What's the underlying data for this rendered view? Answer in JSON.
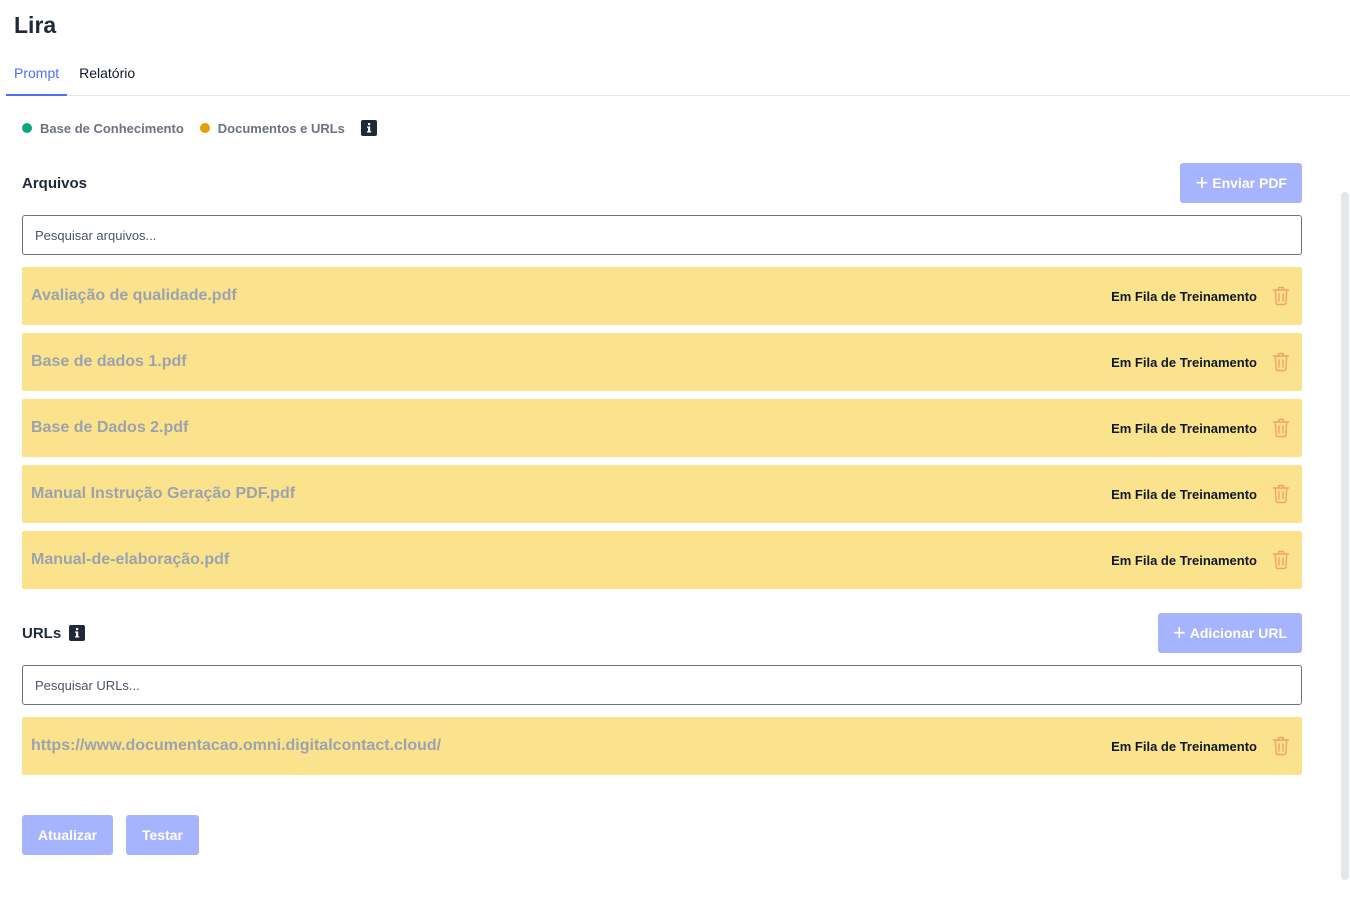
{
  "app": {
    "title": "Lira"
  },
  "tabs": [
    {
      "label": "Prompt",
      "active": true
    },
    {
      "label": "Relatório",
      "active": false
    }
  ],
  "legend": [
    {
      "label": "Base de Conhecimento",
      "color": "#10a37f"
    },
    {
      "label": "Documentos e URLs",
      "color": "#e3a008"
    }
  ],
  "files": {
    "title": "Arquivos",
    "upload_button": "Enviar PDF",
    "search_placeholder": "Pesquisar arquivos...",
    "items": [
      {
        "name": "Avaliação de qualidade.pdf",
        "status": "Em Fila de Treinamento"
      },
      {
        "name": "Base de dados 1.pdf",
        "status": "Em Fila de Treinamento"
      },
      {
        "name": "Base de Dados 2.pdf",
        "status": "Em Fila de Treinamento"
      },
      {
        "name": "Manual Instrução Geração PDF.pdf",
        "status": "Em Fila de Treinamento"
      },
      {
        "name": "Manual-de-elaboração.pdf",
        "status": "Em Fila de Treinamento"
      }
    ]
  },
  "urls": {
    "title": "URLs",
    "add_button": "Adicionar URL",
    "search_placeholder": "Pesquisar URLs...",
    "items": [
      {
        "name": "https://www.documentacao.omni.digitalcontact.cloud/",
        "status": "Em Fila de Treinamento"
      }
    ]
  },
  "actions": {
    "update": "Atualizar",
    "test": "Testar"
  },
  "colors": {
    "accent": "#4f6ef7",
    "button": "#a5b4fc",
    "row": "#fae38c",
    "trash": "#f4a261"
  }
}
